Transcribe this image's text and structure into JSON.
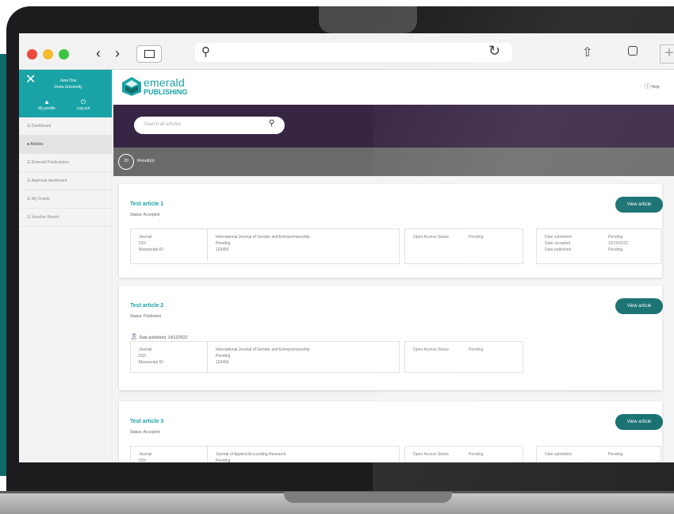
{
  "browser": {
    "url_placeholder": "",
    "share_icon": "share-icon",
    "reload_icon": "reload-icon",
    "plus": "+"
  },
  "sidebar": {
    "user_name": "Jane Doe",
    "user_org": "Doria University",
    "profile_label": "My profile",
    "logout_label": "Log out",
    "items": [
      {
        "label": "☰  Dashboard"
      },
      {
        "label": "●  Articles"
      },
      {
        "label": "☰  Emerald Publications"
      },
      {
        "label": "☰  Approval dashboard"
      },
      {
        "label": "☰  My Grants"
      },
      {
        "label": "☰  Voucher Report"
      }
    ]
  },
  "header": {
    "logo_line1": "emerald",
    "logo_line2": "PUBLISHING",
    "help_label": "Help"
  },
  "search": {
    "placeholder": "Search all articles"
  },
  "results": {
    "count": "20",
    "label": "Result(s)"
  },
  "articles": [
    {
      "title": "Test article 1",
      "status": "Status: Accepted",
      "button": "View article",
      "info_labels": "Journal\nDOI\nManuscript ID",
      "info_values": "International Journal of Gender and Entrepreneurship\nPending\n123456",
      "oa_label": "Open Access Status",
      "oa_value": "Pending",
      "date_labels": "Date submitted\nDate accepted\nDate published",
      "date_values": "Pending\n10/10/2022\nPending"
    },
    {
      "title": "Test article 2",
      "status": "Status: Published",
      "button": "View article",
      "published": "Date published: 14/12/2022",
      "info_labels": "Journal\nDOI\nManuscript ID",
      "info_values": "International Journal of Gender and Entrepreneurship\nPending\n123456",
      "oa_label": "Open Access Status",
      "oa_value": "Pending"
    },
    {
      "title": "Test article 3",
      "status": "Status: Accepted",
      "button": "View article",
      "info_labels": "Journal\nDOI",
      "info_values": "Journal of Applied Accounting Research\nPending",
      "oa_label": "Open Access Status",
      "oa_value": "Pending",
      "date_labels": "Date submitted",
      "date_values": "Pending"
    }
  ]
}
